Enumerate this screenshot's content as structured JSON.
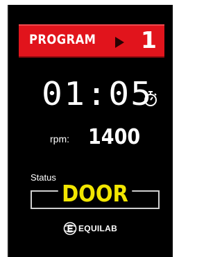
{
  "program": {
    "label": "PROGRAM",
    "arrow_icon": "play-arrow-icon",
    "number": "1"
  },
  "timer": {
    "time": "01:05",
    "icon": "stopwatch-icon"
  },
  "speed": {
    "label": "rpm:",
    "value": "1400"
  },
  "status": {
    "label": "Status",
    "value": "DOOR"
  },
  "brand": {
    "logo_icon": "equilab-logo-icon",
    "name": "EQUILAB"
  },
  "colors": {
    "background": "#000000",
    "program_bar": "#e1141c",
    "status_text": "#f2e600",
    "text": "#ffffff"
  }
}
